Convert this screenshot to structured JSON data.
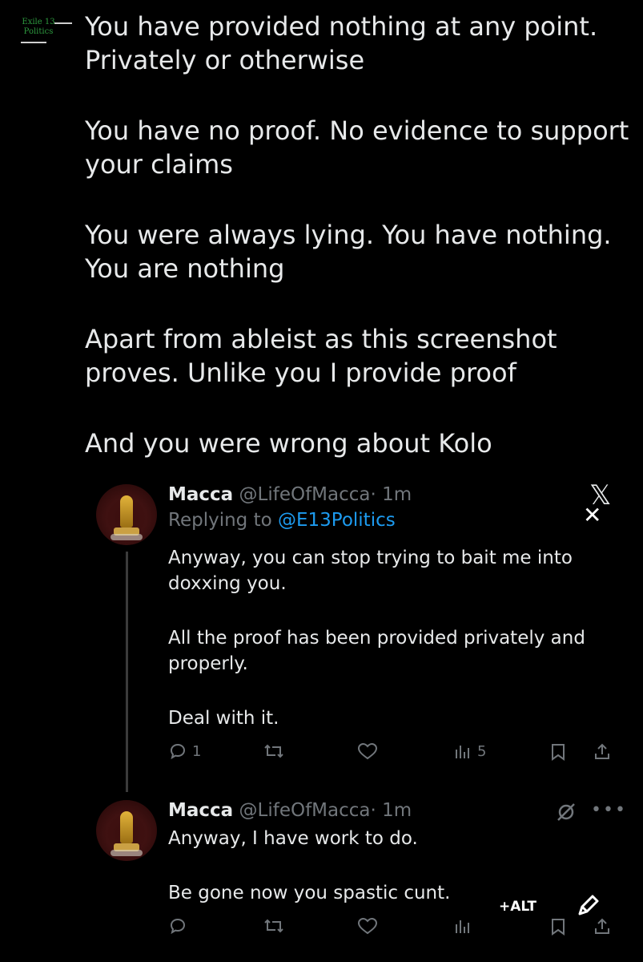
{
  "watermark": {
    "line1": "Exile 13",
    "line2": "Politics"
  },
  "main_tweet": {
    "paragraphs": [
      "You have provided nothing at any point. Privately or otherwise",
      "You have no proof. No evidence to support your claims",
      "You were always lying. You have nothing. You are nothing",
      "Apart from ableist as this screenshot proves. Unlike you I provide proof",
      "And you were wrong about Kolo"
    ]
  },
  "quoted_tweets": [
    {
      "name": "Macca",
      "handle": "@LifeOfMacca",
      "time": "· 1m",
      "replying_to_prefix": "Replying to ",
      "replying_to_handle": "@E13Politics",
      "paragraphs": [
        "Anyway, you can stop trying to bait me into doxxing you.",
        "All the proof has been provided privately and properly.",
        "Deal with it."
      ],
      "counts": {
        "replies": "1",
        "reposts": "",
        "likes": "",
        "views": "5"
      }
    },
    {
      "name": "Macca",
      "handle": "@LifeOfMacca",
      "time": "· 1m",
      "paragraphs": [
        "Anyway, I have work to do.",
        "Be gone now you spastic cunt."
      ],
      "counts": {
        "replies": "",
        "reposts": "",
        "likes": "",
        "views": ""
      }
    }
  ],
  "overlay": {
    "x_logo": "𝕏",
    "close": "✕",
    "alt_label": "+ALT",
    "more": "•••"
  },
  "colors": {
    "background": "#000000",
    "text": "#e7e9ea",
    "muted": "#71767b",
    "link": "#1d9bf0",
    "watermark": "#2e9a3f"
  }
}
